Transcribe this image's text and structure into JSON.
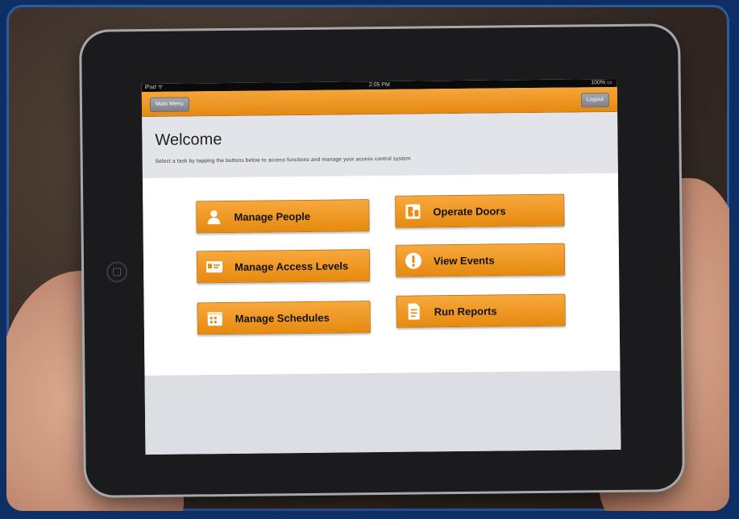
{
  "status_bar": {
    "carrier": "iPad ᯤ",
    "time": "2:05 PM",
    "battery": "100% ▭"
  },
  "nav": {
    "menu_label": "Main Menu",
    "logout_label": "Logout",
    "accent_color": "#f29a25"
  },
  "welcome": {
    "title": "Welcome",
    "subtitle": "Select a task by tapping the buttons below to access functions and manage your access control system"
  },
  "menu": {
    "items": [
      {
        "label": "Manage People",
        "icon": "person-icon"
      },
      {
        "label": "Operate Doors",
        "icon": "door-icon"
      },
      {
        "label": "Manage Access Levels",
        "icon": "id-card-icon"
      },
      {
        "label": "View Events",
        "icon": "alert-icon"
      },
      {
        "label": "Manage Schedules",
        "icon": "calendar-icon"
      },
      {
        "label": "Run Reports",
        "icon": "report-icon"
      }
    ]
  }
}
